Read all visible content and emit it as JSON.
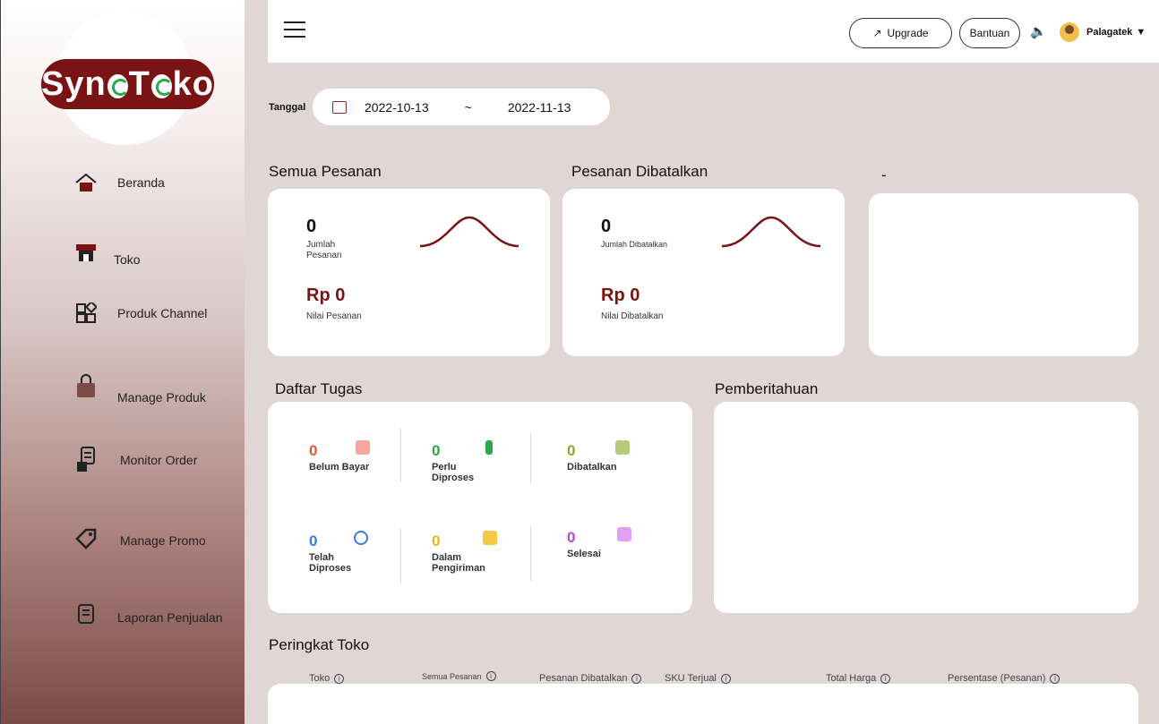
{
  "logo": {
    "brand": "SynToko"
  },
  "sidebar": {
    "items": [
      {
        "label": "Beranda",
        "icon": "home-icon"
      },
      {
        "label": "Toko",
        "icon": "store-icon"
      },
      {
        "label": "Produk Channel",
        "icon": "grid-icon"
      },
      {
        "label": "Manage Produk",
        "icon": "bag-icon"
      },
      {
        "label": "Monitor Order",
        "icon": "order-icon"
      },
      {
        "label": "Manage Promo",
        "icon": "tag-icon"
      },
      {
        "label": "Laporan Penjualan",
        "icon": "report-icon"
      }
    ]
  },
  "topbar": {
    "upgrade_label": "Upgrade",
    "bantuan_label": "Bantuan",
    "user_name": "Palagatek"
  },
  "date_filter": {
    "label": "Tanggal",
    "start": "2022-10-13",
    "separator": "~",
    "end": "2022-11-13"
  },
  "semua_pesanan": {
    "title": "Semua Pesanan",
    "count": "0",
    "count_label": "Jumlah Pesanan",
    "value": "Rp 0",
    "value_label": "Nilai Pesanan"
  },
  "pesanan_dibatalkan": {
    "title": "Pesanan Dibatalkan",
    "count": "0",
    "count_label": "Jumlah Dibatalkan",
    "value": "Rp 0",
    "value_label": "Nilai Dibatalkan"
  },
  "third_panel": {
    "title": "-"
  },
  "daftar_tugas": {
    "title": "Daftar Tugas",
    "tasks": [
      {
        "count": "0",
        "label": "Belum Bayar",
        "color": "#e05a2b"
      },
      {
        "count": "0",
        "label": "Perlu\nDiproses",
        "color": "#2aa84a"
      },
      {
        "count": "0",
        "label": "Dibatalkan",
        "color": "#8aa82a"
      },
      {
        "count": "0",
        "label": "Telah\nDiproses",
        "color": "#3a7be0"
      },
      {
        "count": "0",
        "label": "Dalam\nPengiriman",
        "color": "#f0b020"
      },
      {
        "count": "0",
        "label": "Selesai",
        "color": "#c040e0"
      }
    ]
  },
  "pemberitahuan": {
    "title": "Pemberitahuan"
  },
  "peringkat": {
    "title": "Peringkat Toko",
    "columns": [
      "Toko",
      "Semua Pesanan",
      "Pesanan Dibatalkan",
      "SKU Terjual",
      "Total Harga",
      "Persentase (Pesanan)"
    ]
  }
}
